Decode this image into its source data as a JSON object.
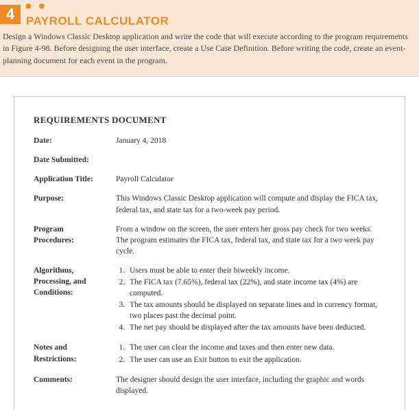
{
  "header": {
    "number": "4",
    "dots": "● ●",
    "title": "PAYROLL CALCULATOR",
    "intro": "Design a Windows Classic Desktop application and write the code that will execute according to the program requirements in Figure 4-98. Before designing the user interface, create a Use Case Definition. Before writing the code, create an event-planning document for each event in the program."
  },
  "doc": {
    "heading": "REQUIREMENTS DOCUMENT",
    "date_label": "Date:",
    "date_value": "January 4, 2018",
    "submitted_label": "Date Submitted:",
    "submitted_value": "",
    "app_title_label": "Application Title:",
    "app_title_value": "Payroll Calculator",
    "purpose_label": "Purpose:",
    "purpose_value": "This Windows Classic Desktop application will compute and display the FICA tax, federal tax, and state tax for a two-week pay period.",
    "procedures_label_l1": "Program",
    "procedures_label_l2": "Procedures:",
    "procedures_value": "From a window on the screen, the user enters her gross pay check for two weeks. The program estimates the FICA tax, federal tax, and state tax for a two week pay cycle.",
    "algorithms_label_l1": "Algorithms,",
    "algorithms_label_l2": "Processing, and",
    "algorithms_label_l3": "Conditions:",
    "algo_1": "Users must be able to enter their biweekly income.",
    "algo_2": "The FICA tax (7.65%), federal tax (22%), and state income tax (4%) are computed.",
    "algo_3": "The tax amounts should be displayed on separate lines and in currency format, two places past the decimal point.",
    "algo_4": "The net pay should be displayed after the tax amounts have been deducted.",
    "notes_label_l1": "Notes and",
    "notes_label_l2": "Restrictions:",
    "note_1": "The user can clear the income and taxes and then enter new data.",
    "note_2": "The user can use an Exit button to exit the application.",
    "comments_label": "Comments:",
    "comments_value": "The designer should design the user interface, including the graphic and words displayed."
  }
}
